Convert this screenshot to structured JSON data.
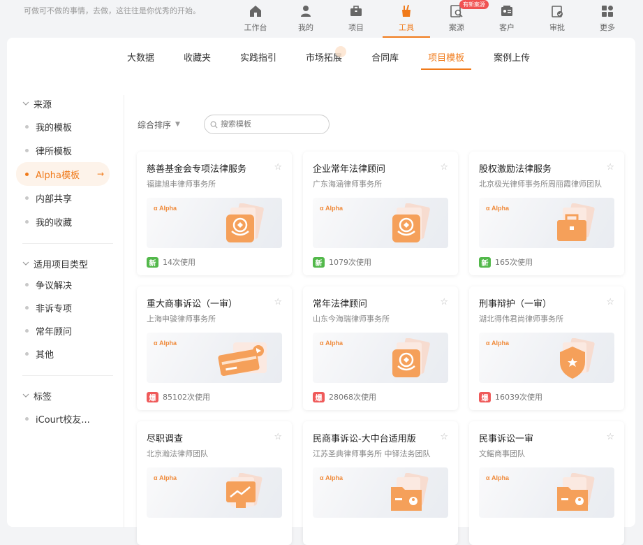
{
  "header": {
    "slogan": "可做可不做的事情，去做，这往往是你优秀的开始。",
    "nav": [
      {
        "label": "工作台",
        "icon": "home-icon"
      },
      {
        "label": "我的",
        "icon": "user-icon"
      },
      {
        "label": "项目",
        "icon": "briefcase-icon"
      },
      {
        "label": "工具",
        "icon": "tools-icon"
      },
      {
        "label": "案源",
        "icon": "case-search-icon",
        "badge": "有新案源"
      },
      {
        "label": "客户",
        "icon": "client-card-icon"
      },
      {
        "label": "审批",
        "icon": "approval-icon"
      },
      {
        "label": "更多",
        "icon": "grid-more-icon"
      }
    ],
    "active_nav": "工具",
    "accent": "#f07a1a"
  },
  "tabs": [
    "大数据",
    "收藏夹",
    "实践指引",
    "市场拓展",
    "合同库",
    "项目模板",
    "案例上传"
  ],
  "active_tab": "项目模板",
  "sidebar": {
    "source": {
      "title": "来源",
      "items": [
        "我的模板",
        "律所模板",
        "Alpha模板",
        "内部共享",
        "我的收藏"
      ],
      "active": "Alpha模板"
    },
    "project_type": {
      "title": "适用项目类型",
      "items": [
        "争议解决",
        "非诉专项",
        "常年顾问",
        "其他"
      ]
    },
    "tags": {
      "title": "标签",
      "items": [
        "iCourt校友..."
      ]
    }
  },
  "toolbar": {
    "sort_label": "综合排序",
    "search_placeholder": "搜索模板"
  },
  "cards": [
    {
      "title": "慈善基金会专项法律服务",
      "org": "福建旭丰律师事务所",
      "tag": "新",
      "tag_type": "new",
      "uses": "14次使用",
      "art": "badge-hand"
    },
    {
      "title": "企业常年法律顾问",
      "org": "广东海涵律师事务所",
      "tag": "新",
      "tag_type": "new",
      "uses": "1079次使用",
      "art": "badge-hand"
    },
    {
      "title": "股权激励法律服务",
      "org": "北京极光律师事务所周丽霞律师团队",
      "tag": "新",
      "tag_type": "new",
      "uses": "165次使用",
      "art": "briefcase"
    },
    {
      "title": "重大商事诉讼（一审）",
      "org": "上海申骏律师事务所",
      "tag": "爆",
      "tag_type": "hot",
      "uses": "85102次使用",
      "art": "card"
    },
    {
      "title": "常年法律顾问",
      "org": "山东今海瑞律师事务所",
      "tag": "爆",
      "tag_type": "hot",
      "uses": "28068次使用",
      "art": "badge-hand"
    },
    {
      "title": "刑事辩护（一审）",
      "org": "湖北得伟君尚律师事务所",
      "tag": "爆",
      "tag_type": "hot",
      "uses": "16039次使用",
      "art": "shield"
    },
    {
      "title": "尽职调查",
      "org": "北京瀚法律师团队",
      "tag": "",
      "tag_type": "",
      "uses": "",
      "art": "chart"
    },
    {
      "title": "民商事诉讼-大中台适用版",
      "org": "江苏圣典律师事务所 中铎法务团队",
      "tag": "",
      "tag_type": "",
      "uses": "",
      "art": "folder"
    },
    {
      "title": "民事诉讼一审",
      "org": "文鳐商事团队",
      "tag": "",
      "tag_type": "",
      "uses": "",
      "art": "folder"
    }
  ],
  "thumb_brand": "Alpha"
}
